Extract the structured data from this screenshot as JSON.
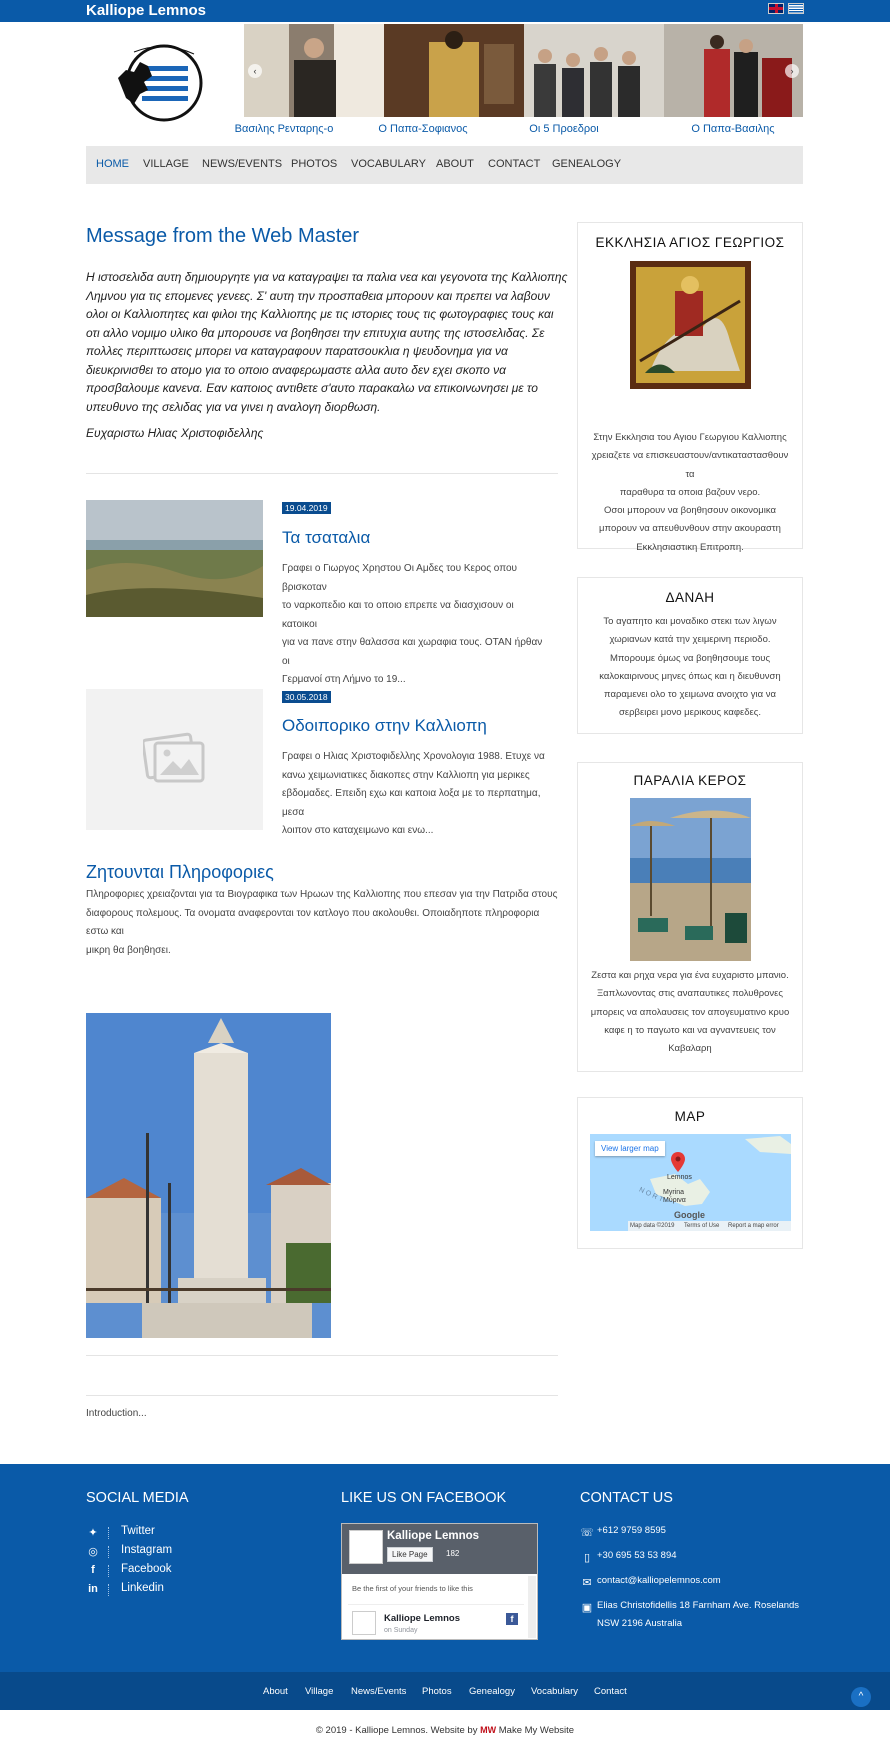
{
  "header": {
    "site_title": "Kalliope Lemnos",
    "languages": [
      "English",
      "Greek"
    ]
  },
  "slider": {
    "captions": [
      "Βασιλης Ρενταρης-ο",
      "Ο Παπα-Σοφιανος",
      "Οι 5 Προεδροι",
      "Ο Παπα-Βασιλης"
    ],
    "prev": "‹",
    "next": "›"
  },
  "nav": {
    "items": [
      "HOME",
      "VILLAGE",
      "NEWS/EVENTS",
      "PHOTOS",
      "VOCABULARY",
      "ABOUT",
      "CONTACT",
      "GENEALOGY"
    ]
  },
  "main": {
    "message_title": "Message from the Web Master",
    "message_lines": [
      "Η ιστοσελιδα αυτη δημιουργητε για να καταγραψει τα παλια νεα και γεγονοτα της Καλλιοπης",
      "Λημνου για τις επομενες γενεες. Σ' αυτη την προσπαθεια μπορουν και πρεπει να λαβουν",
      "ολοι οι Καλλιοπητες και φιλοι της Καλλιοπης με τις ιστοριες τους τις φωτογραφιες τους και",
      "οτι αλλο νομιμο υλικο θα μπορουσε να βοηθησει την επιτυχια αυτης της ιστοσελιδας. Σε",
      "πολλες περιπτωσεις μπορει να καταγραφουν παρατσουκλια η ψευδονημα για να",
      "διευκρινισθει το ατομο για το οποιο αναφερωμαστε αλλα αυτο δεν εχει σκοπο να",
      "προσβαλουμε κανενα. Εαν καποιος αντιθετε σ'αυτο παρακαλω να επικοινωνησει με το",
      "υπευθυνο της σελιδας για να γινει η αναλογη διορθωση."
    ],
    "signature": "Ευχαριστω Ηλιας Χριστοφιδελλης",
    "posts": [
      {
        "date": "19.04.2019",
        "title": "Τα τσαταλια",
        "lines": [
          "Γραφει ο Γιωργος Χρηστου Οι Αμδες του Κερος οπου βρισκοταν",
          "το ναρκοπεδιο και το οποιο επρεπε να διασχισουν οι κατοικοι",
          "για να πανε στην θαλασσα και χωραφια τους. ΟΤΑΝ ήρθαν οι",
          "Γερμανοί στη Λήμνο το 19..."
        ]
      },
      {
        "date": "30.05.2018",
        "title": "Οδοιπορικο στην Καλλιοπη",
        "lines": [
          "Γραφει ο Ηλιας Χριστοφιδελλης Χρονολογια 1988. Ετυχε να",
          "κανω χειμωνιατικες διακοπες στην Καλλιοπη για μερικες",
          "εβδομαδες. Επειδη εχω και καποια λοξα με το περπατημα, μεσα",
          "λοιπον στο καταχειμωνο και ενω..."
        ]
      }
    ],
    "info_title": "Ζητουνται Πληροφοριες",
    "info_lines": [
      "Πληροφοριες χρειαζονται για τα Βιογραφικα των Ηρωων της Καλλιοπης που επεσαν για την Πατριδα στους",
      "διαφορους πολεμους. Τα ονοματα αναφερονται τον κατλογο που ακολουθει. Οποιαδηποτε πληροφορια εστω και",
      "μικρη θα βοηθησει."
    ],
    "intro": "Introduction..."
  },
  "sidebar": {
    "church": {
      "title": "ΕΚΚΛΗΣΙΑ ΑΓΙΟΣ ΓΕΩΡΓΙΟΣ",
      "lines": [
        "Στην Εκκλησια του Αγιου Γεωργιου Καλλιοπης",
        "χρειαζετε να επισκευαστουν/αντικαταστασθουν τα",
        "παραθυρα τα οποια βαζουν νερο.",
        "Οσοι μπορουν να βοηθησουν οικονομικα",
        "μπορουν να απευθυνθουν στην ακουραστη",
        "Εκκλησιαστικη Επιτροπη."
      ]
    },
    "dana": {
      "title": "ΔΑΝΑΗ",
      "lines": [
        "Το αγαπητο και μοναδικο στεκι των λιγων",
        "χωριανων κατά την χειμερινη περιοδο.",
        "Μπορουμε όμως να βοηθησουμε τους",
        "καλοκαιρινους μηνες όπως και η διευθυνση",
        "παραμενει ολο το χειμωνα ανοιχτο για να",
        "σερβειρει μονο μερικους καφεδες."
      ]
    },
    "beach": {
      "title": "ΠΑΡΑΛΙΑ ΚΕΡΟΣ",
      "lines": [
        "Ζεστα και ρηχα νερα για ένα ευχαριστο μπανιο.",
        "Ξαπλωνοντας στις αναπαυτικες πολυθρονες",
        "μπορεις να απολαυσεις τον απογευματινο κρυο",
        "καφε η το παγωτο και να αγναντευεις τον",
        "Καβαλαρη"
      ]
    },
    "map": {
      "title": "MAP",
      "view_larger": "View larger map",
      "label_lemnos": "Lemnos",
      "label_myrina1": "Myrina",
      "label_myrina2": "Μύρινα",
      "label_north": "NORT",
      "google": "Google",
      "map_data": "Map data ©2019",
      "terms": "Terms of Use",
      "report": "Report a map error"
    }
  },
  "footer": {
    "social_title": "SOCIAL MEDIA",
    "social": [
      {
        "icon": "twitter-icon",
        "label": "Twitter"
      },
      {
        "icon": "instagram-icon",
        "label": "Instagram"
      },
      {
        "icon": "facebook-icon",
        "label": "Facebook"
      },
      {
        "icon": "linkedin-icon",
        "label": "Linkedin"
      }
    ],
    "fb_title": "LIKE US ON FACEBOOK",
    "fb_widget": {
      "page_name": "Kalliope Lemnos",
      "like_button": "Like Page",
      "likes": "182",
      "friends_text": "Be the first of your friends to like this",
      "post_author": "Kalliope Lemnos",
      "post_time": "on Sunday"
    },
    "contact_title": "CONTACT US",
    "contact": {
      "phone": "+612 9759 8595",
      "mobile": "+30 695 53 53 894",
      "email": "contact@kalliopelemnos.com",
      "address1": "Elias Christofidellis 18 Farnham Ave. Roselands",
      "address2": "NSW 2196 Australia"
    },
    "bottom_links": [
      "About",
      "Village",
      "News/Events",
      "Photos",
      "Genealogy",
      "Vocabulary",
      "Contact"
    ],
    "copyright": "© 2019 - Kalliope Lemnos. Website by",
    "copyright_brand": "Make My Website",
    "to_top": "^"
  },
  "colors": {
    "primary": "#0a5aa8",
    "footer_bottom": "#084a8b",
    "nav_bg": "#e8e8e8"
  }
}
